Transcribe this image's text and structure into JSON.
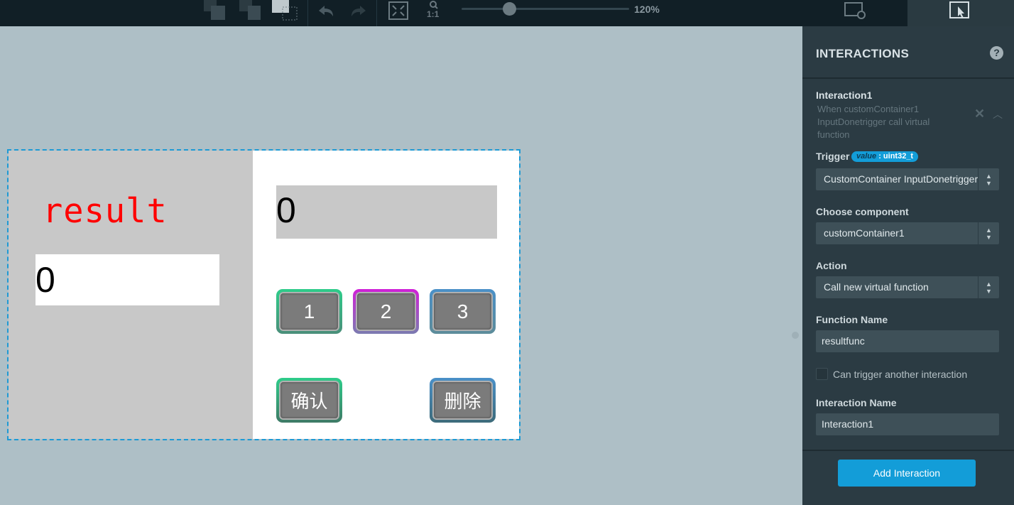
{
  "toolbar": {
    "one_to_one": "1:1",
    "zoom_level": "120%",
    "zoom_fraction": 0.25
  },
  "canvas": {
    "result_label": "result",
    "result_value": "0",
    "input_value": "0",
    "keys": {
      "k1": "1",
      "k2": "2",
      "k3": "3",
      "confirm": "确认",
      "delete": "删除"
    }
  },
  "panel": {
    "title": "INTERACTIONS",
    "help": "?",
    "interaction": {
      "title": "Interaction1",
      "description": "When customContainer1 InputDonetrigger call virtual function"
    },
    "trigger": {
      "label": "Trigger",
      "param_name": "value",
      "param_type": "uint32_t",
      "value": "CustomContainer InputDonetrigger"
    },
    "component": {
      "label": "Choose component",
      "value": "customContainer1"
    },
    "action": {
      "label": "Action",
      "value": "Call new virtual function"
    },
    "function_name": {
      "label": "Function Name",
      "value": "resultfunc"
    },
    "can_trigger": {
      "label": "Can trigger another interaction",
      "checked": false
    },
    "interaction_name": {
      "label": "Interaction Name",
      "value": "Interaction1"
    },
    "add_button": "Add Interaction"
  },
  "colors": {
    "toolbar_bg": "#111f26",
    "canvas_bg": "#aebfc6",
    "panel_bg": "#2b3b43",
    "accent": "#139dd8",
    "result_text": "#ff0000",
    "key_border_green": "#2ecc8a",
    "key_border_magenta": "#d020d8",
    "key_border_blue": "#4a90c8"
  }
}
